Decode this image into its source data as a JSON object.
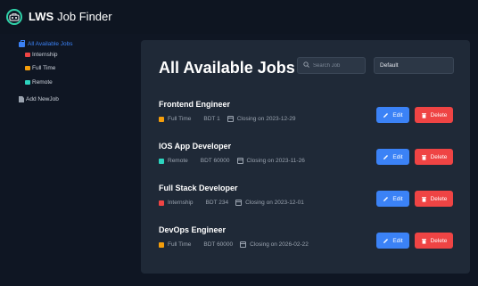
{
  "app": {
    "brand_bold": "LWS",
    "brand_rest": "Job Finder"
  },
  "sidebar": {
    "all_jobs": "All Available Jobs",
    "types": [
      {
        "label": "Internship",
        "color": "#ef4444"
      },
      {
        "label": "Full Time",
        "color": "#f59e0b"
      },
      {
        "label": "Remote",
        "color": "#2dd4bf"
      }
    ],
    "add_job": "Add NewJob"
  },
  "main": {
    "title": "All Available Jobs",
    "search_placeholder": "Search Job",
    "sort_value": "Default",
    "edit_label": "Edit",
    "delete_label": "Delete",
    "jobs": [
      {
        "title": "Frontend Engineer",
        "type": "Full Time",
        "type_color": "#f59e0b",
        "salary": "BDT 1",
        "deadline": "Closing on 2023-12-29"
      },
      {
        "title": "IOS App Developer",
        "type": "Remote",
        "type_color": "#2dd4bf",
        "salary": "BDT 60000",
        "deadline": "Closing on 2023-11-26"
      },
      {
        "title": "Full Stack Developer",
        "type": "Internship",
        "type_color": "#ef4444",
        "salary": "BDT 234",
        "deadline": "Closing on 2023-12-01"
      },
      {
        "title": "DevOps Engineer",
        "type": "Full Time",
        "type_color": "#f59e0b",
        "salary": "BDT 60000",
        "deadline": "Closing on 2026-02-22"
      }
    ]
  },
  "colors": {
    "accent": "#3b82f6",
    "danger": "#ef4444",
    "panel": "#1f2937",
    "background": "#0f1623"
  }
}
